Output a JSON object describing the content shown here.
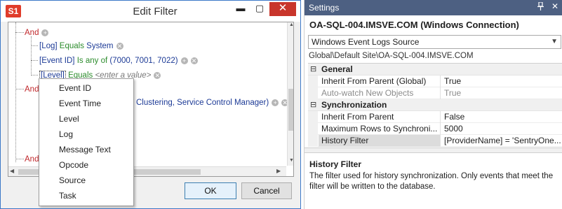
{
  "edit_filter": {
    "app_icon": "S1",
    "title": "Edit Filter",
    "controls": {
      "minimize": "▬",
      "maximize": "▢",
      "close": "✕"
    },
    "tree": {
      "and1": "And",
      "cond1": {
        "field": "[Log]",
        "op": "Equals",
        "value": "System"
      },
      "cond2": {
        "field": "[Event ID]",
        "op": "Is any of",
        "value": "(7000, 7001, 7022)"
      },
      "cond3": {
        "field": "[Level]",
        "op": "Equals",
        "placeholder": "<enter a value>"
      },
      "and2": "And",
      "cond4_value": "Clustering, Service Control Manager)",
      "and3": "And"
    },
    "ok_label": "OK",
    "cancel_label": "Cancel"
  },
  "context_menu": {
    "items": [
      "Event ID",
      "Event Time",
      "Level",
      "Log",
      "Message Text",
      "Opcode",
      "Source",
      "Task"
    ]
  },
  "settings": {
    "title": "Settings",
    "pin_icon": "pin-icon",
    "heading": "OA-SQL-004.IMSVE.COM (Windows Connection)",
    "selected_source": "Windows Event Logs Source",
    "path": "Global\\Default Site\\OA-SQL-004.IMSVE.COM",
    "categories": [
      {
        "name": "General",
        "rows": [
          {
            "name": "Inherit From Parent (Global)",
            "value": "True"
          },
          {
            "name": "Auto-watch New Objects",
            "value": "True"
          }
        ]
      },
      {
        "name": "Synchronization",
        "rows": [
          {
            "name": "Inherit From Parent",
            "value": "False"
          },
          {
            "name": "Maximum Rows to Synchroni...",
            "value": "5000"
          },
          {
            "name": "History Filter",
            "value": "[ProviderName] = 'SentryOne..."
          }
        ]
      }
    ],
    "description_title": "History Filter",
    "description": "The filter used for history synchronization. Only events that meet the filter will be written to the database."
  }
}
